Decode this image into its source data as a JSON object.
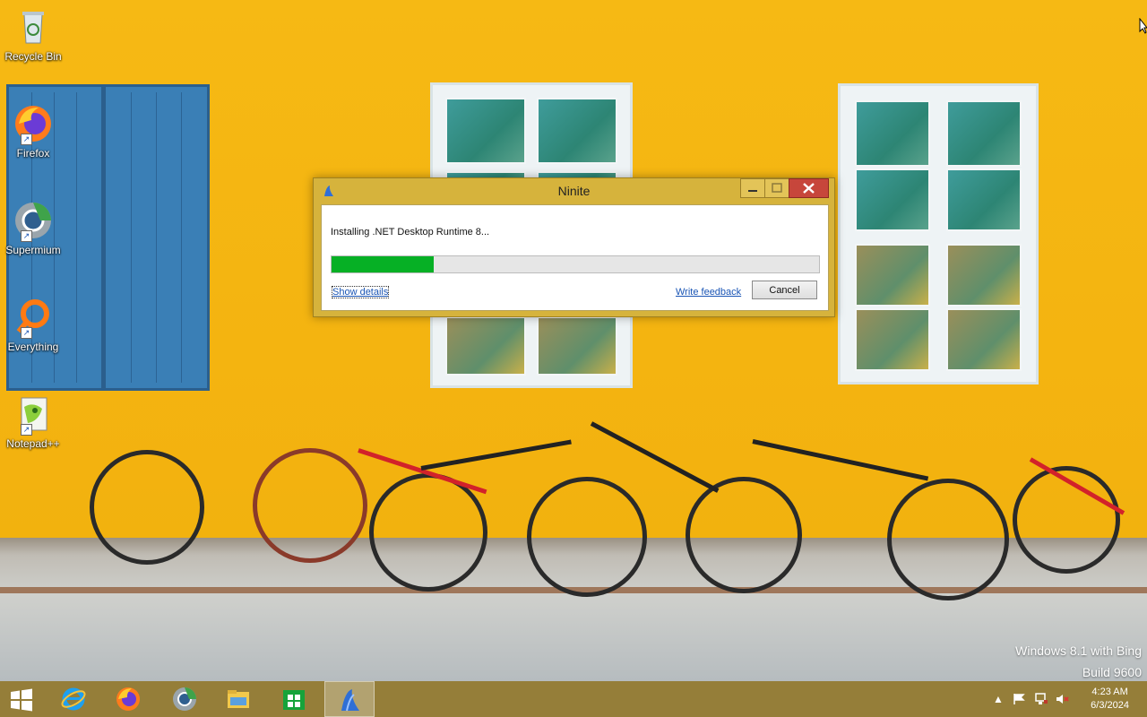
{
  "desktop": {
    "icons": [
      {
        "label": "Recycle Bin",
        "icon": "recycle-bin-icon"
      },
      {
        "label": "Firefox",
        "icon": "firefox-icon"
      },
      {
        "label": "Supermium",
        "icon": "supermium-icon"
      },
      {
        "label": "Everything",
        "icon": "everything-icon"
      },
      {
        "label": "Notepad++",
        "icon": "notepadpp-icon"
      }
    ]
  },
  "dialog": {
    "title": "Ninite",
    "status": "Installing .NET Desktop Runtime 8...",
    "progress_percent": 21,
    "show_details": "Show details",
    "write_feedback": "Write feedback",
    "cancel": "Cancel"
  },
  "watermark": {
    "line1": "Windows 8.1 with Bing",
    "line2": "Build 9600"
  },
  "taskbar": {
    "pinned": [
      "internet-explorer-icon",
      "firefox-icon",
      "supermium-icon",
      "file-explorer-icon",
      "store-icon",
      "ninite-icon"
    ],
    "active": "ninite-icon",
    "clock_time": "4:23 AM",
    "clock_date": "6/3/2024"
  },
  "colors": {
    "wall": "#f3b20f",
    "progress_fill": "#06b025",
    "dialog_frame": "#d6b33c",
    "taskbar": "#8c7328"
  }
}
